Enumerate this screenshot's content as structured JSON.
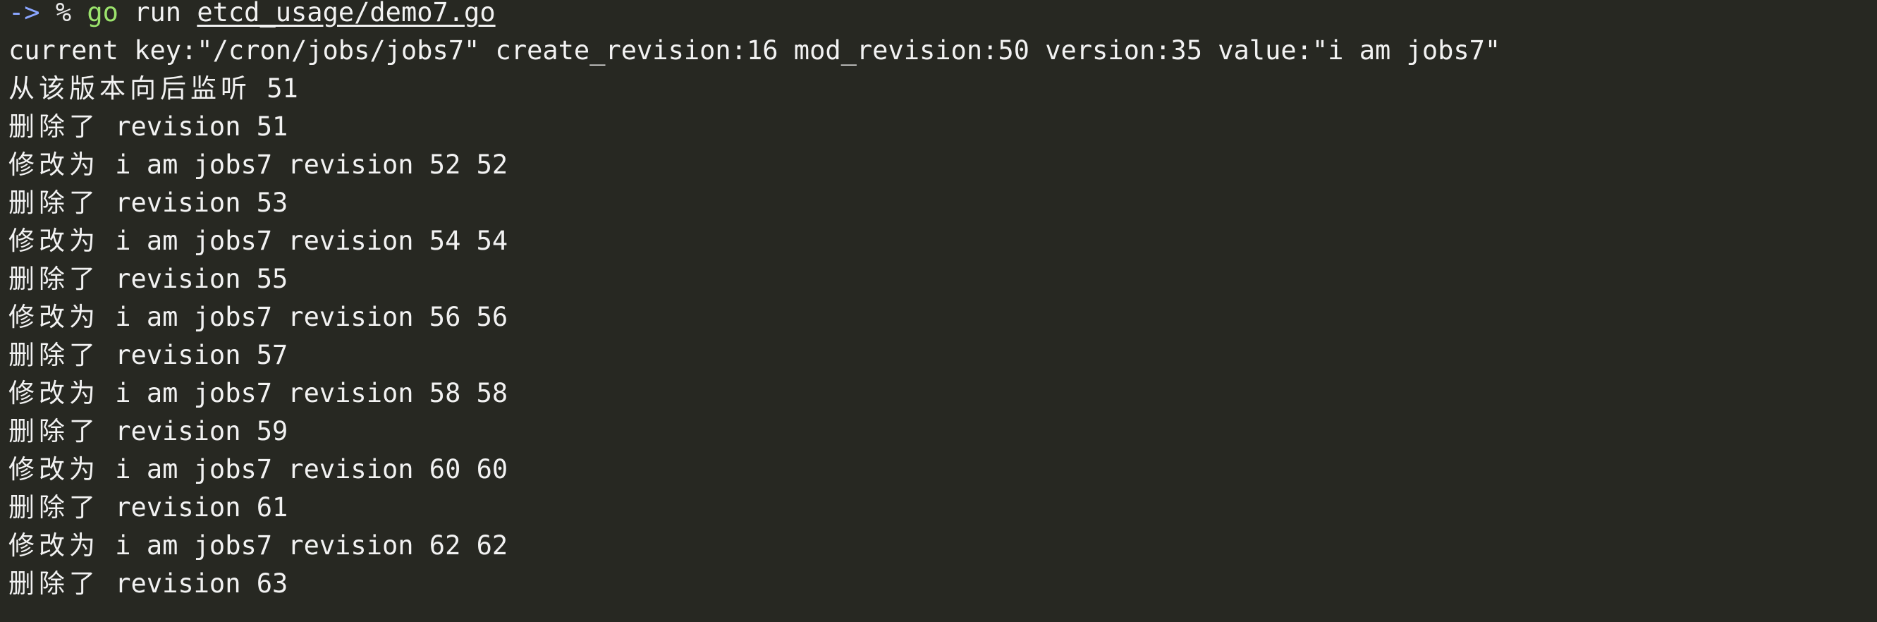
{
  "terminal": {
    "prompt": {
      "arrow": "->",
      "symbol": "%",
      "command": "go",
      "subcommand": "run",
      "file": "etcd_usage/demo7.go"
    },
    "lines": [
      "current key:\"/cron/jobs/jobs7\" create_revision:16 mod_revision:50 version:35 value:\"i am jobs7\"",
      {
        "cjk": "从该版本向后监听",
        "text": " 51"
      },
      {
        "cjk": "删除了",
        "text": " revision 51"
      },
      {
        "cjk": "修改为",
        "text": " i am jobs7 revision 52 52"
      },
      {
        "cjk": "删除了",
        "text": " revision 53"
      },
      {
        "cjk": "修改为",
        "text": " i am jobs7 revision 54 54"
      },
      {
        "cjk": "删除了",
        "text": " revision 55"
      },
      {
        "cjk": "修改为",
        "text": " i am jobs7 revision 56 56"
      },
      {
        "cjk": "删除了",
        "text": " revision 57"
      },
      {
        "cjk": "修改为",
        "text": " i am jobs7 revision 58 58"
      },
      {
        "cjk": "删除了",
        "text": " revision 59"
      },
      {
        "cjk": "修改为",
        "text": " i am jobs7 revision 60 60"
      },
      {
        "cjk": "删除了",
        "text": " revision 61"
      },
      {
        "cjk": "修改为",
        "text": " i am jobs7 revision 62 62"
      },
      {
        "cjk": "删除了",
        "text": " revision 63"
      }
    ]
  },
  "colors": {
    "background": "#272822",
    "foreground": "#f2f2f2",
    "prompt_arrow": "#8aa6ff",
    "command": "#9be36c"
  }
}
